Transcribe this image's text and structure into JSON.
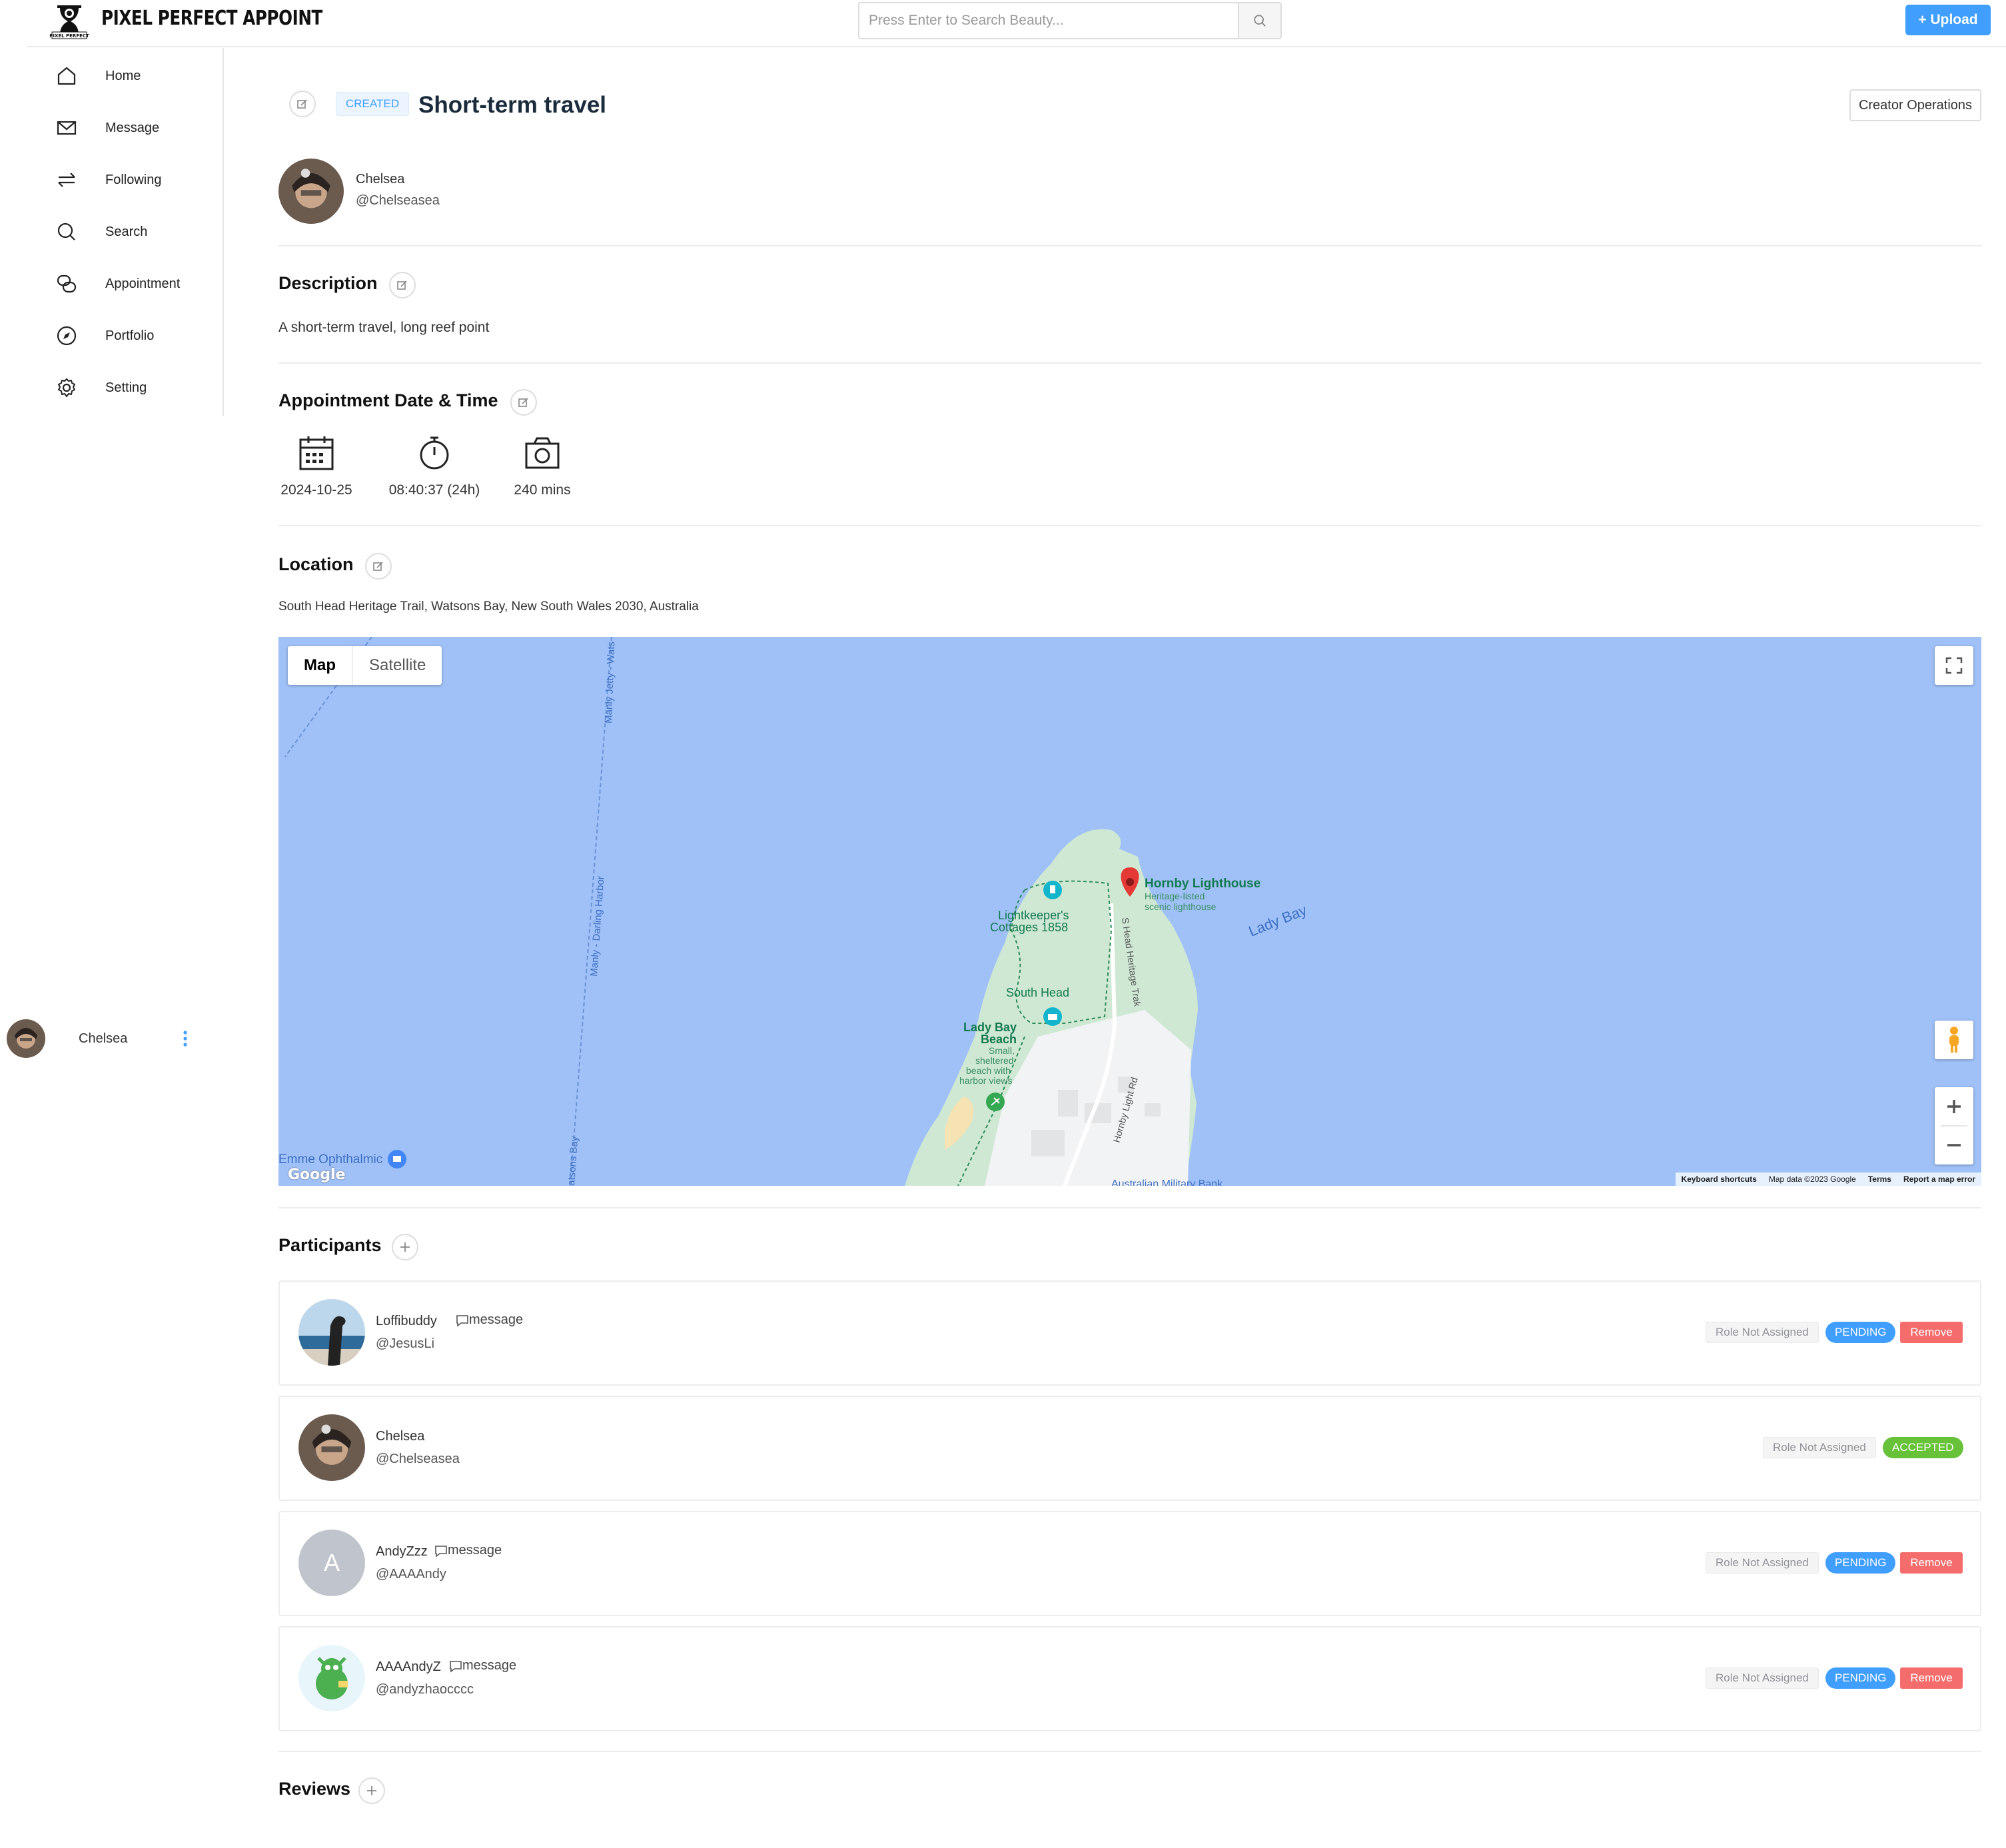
{
  "app": {
    "title": "PIXEL PERFECT APPOINT",
    "logo_small_text": "PIXEL PERFECT"
  },
  "search": {
    "placeholder": "Press Enter to Search Beauty..."
  },
  "header": {
    "upload_label": "+ Upload",
    "accent": "#409eff"
  },
  "sidebar": {
    "items": [
      {
        "label": "Home",
        "icon": "home-icon"
      },
      {
        "label": "Message",
        "icon": "mail-icon"
      },
      {
        "label": "Following",
        "icon": "following-icon"
      },
      {
        "label": "Search",
        "icon": "search-icon"
      },
      {
        "label": "Appointment",
        "icon": "appointment-icon"
      },
      {
        "label": "Portfolio",
        "icon": "compass-icon"
      },
      {
        "label": "Setting",
        "icon": "gear-icon"
      }
    ],
    "user": {
      "name": "Chelsea"
    }
  },
  "appointment": {
    "status": "CREATED",
    "title": "Short-term travel",
    "creator_ops_label": "Creator Operations",
    "creator": {
      "name": "Chelsea",
      "handle": "@Chelseasea"
    },
    "description_title": "Description",
    "description": "A short-term travel, long reef point",
    "datetime_title": "Appointment Date & Time",
    "date": "2024-10-25",
    "time": "08:40:37 (24h)",
    "duration": "240 mins",
    "location_title": "Location",
    "location": "South Head Heritage Trail, Watsons Bay, New South Wales 2030, Australia"
  },
  "map": {
    "tab_map": "Map",
    "tab_satellite": "Satellite",
    "labels": {
      "manly_jetty": "Manly Jetty - Wats",
      "manly_darling": "Manly - Darling Harbor",
      "watsons_bay": "atsons Bay",
      "hornby": "Hornby Lighthouse",
      "hornby_sub1": "Heritage-listed",
      "hornby_sub2": "scenic lighthouse",
      "lady_bay": "Lady Bay",
      "cottages1": "Lightkeeper's",
      "cottages2": "Cottages 1858",
      "south_head": "South Head",
      "heritage_track": "S Head Heritage Trak",
      "lady_beach1": "Lady Bay",
      "lady_beach2": "Beach",
      "lady_beach3": "Small,",
      "lady_beach4": "sheltered",
      "lady_beach5": "beach with",
      "lady_beach6": "harbor views",
      "hornby_rd": "Hornby Light Rd",
      "emme": "Emme Ophthalmic",
      "military": "Australian Military Bank",
      "google": "Google"
    },
    "footer": {
      "shortcuts": "Keyboard shortcuts",
      "data": "Map data ©2023 Google",
      "terms": "Terms",
      "report": "Report a map error"
    }
  },
  "participants": {
    "title": "Participants",
    "items": [
      {
        "name": "Loffibuddy",
        "handle": "@JesusLi",
        "message_label": "message",
        "role": "Role Not Assigned",
        "status": "PENDING",
        "remove_label": "Remove"
      },
      {
        "name": "Chelsea",
        "handle": "@Chelseasea",
        "message_label": "",
        "role": "Role Not Assigned",
        "status": "ACCEPTED",
        "remove_label": ""
      },
      {
        "name": "AndyZzz",
        "handle": "@AAAAndy",
        "message_label": "message",
        "role": "Role Not Assigned",
        "status": "PENDING",
        "remove_label": "Remove",
        "avatar_letter": "A"
      },
      {
        "name": "AAAAndyZ",
        "handle": "@andyzhaocccc",
        "message_label": "message",
        "role": "Role Not Assigned",
        "status": "PENDING",
        "remove_label": "Remove"
      }
    ]
  },
  "reviews": {
    "title": "Reviews"
  },
  "colors": {
    "pending": "#409eff",
    "accepted": "#67c23a",
    "remove": "#f56c6c",
    "water": "#9fc1f7",
    "park": "#cfe8d4"
  }
}
